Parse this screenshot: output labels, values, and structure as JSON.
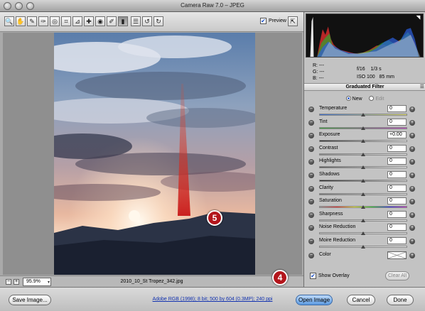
{
  "window": {
    "title": "Camera Raw 7.0  –  JPEG"
  },
  "toolbar": {
    "tools": [
      {
        "name": "zoom-tool",
        "glyph": "🔍"
      },
      {
        "name": "hand-tool",
        "glyph": "✋"
      },
      {
        "name": "white-balance-tool",
        "glyph": "✎"
      },
      {
        "name": "color-sampler-tool",
        "glyph": "✑"
      },
      {
        "name": "targeted-adjustment-tool",
        "glyph": "◎"
      },
      {
        "name": "crop-tool",
        "glyph": "⌗"
      },
      {
        "name": "straighten-tool",
        "glyph": "⊿"
      },
      {
        "name": "spot-removal-tool",
        "glyph": "✚"
      },
      {
        "name": "red-eye-tool",
        "glyph": "◉"
      },
      {
        "name": "adjustment-brush-tool",
        "glyph": "✐"
      },
      {
        "name": "graduated-filter-tool",
        "glyph": "▮"
      },
      {
        "name": "preferences-tool",
        "glyph": "☰"
      },
      {
        "name": "rotate-left-tool",
        "glyph": "↺"
      },
      {
        "name": "rotate-right-tool",
        "glyph": "↻"
      }
    ],
    "active_tool": "graduated-filter-tool",
    "preview_label": "Preview",
    "preview_checked": true
  },
  "status": {
    "zoom": "95.9%",
    "filename": "2010_10_St Tropez_342.jpg"
  },
  "readout": {
    "r_label": "R:",
    "r_value": "---",
    "g_label": "G:",
    "g_value": "---",
    "b_label": "B:",
    "b_value": "---",
    "aperture": "f/16",
    "shutter": "1/3 s",
    "iso": "ISO 100",
    "focal": "85 mm"
  },
  "panel": {
    "title": "Graduated Filter",
    "mode_new": "New",
    "mode_edit": "Edit",
    "mode_selected": "New",
    "params": [
      {
        "label": "Temperature",
        "value": "0",
        "level": 0.5,
        "track": "linear-gradient(90deg,#3b6fd6,#e8e36a)"
      },
      {
        "label": "Tint",
        "value": "0",
        "level": 0.5,
        "track": "linear-gradient(90deg,#3aa33a,#c247c6)"
      },
      {
        "label": "Exposure",
        "value": "+0.00",
        "level": 0.5,
        "track": "linear-gradient(90deg,#222,#fff)"
      },
      {
        "label": "Contrast",
        "value": "0",
        "level": 0.5,
        "track": "linear-gradient(90deg,#888,#eee)"
      },
      {
        "label": "Highlights",
        "value": "0",
        "level": 0.5,
        "track": "linear-gradient(90deg,#555,#fff)"
      },
      {
        "label": "Shadows",
        "value": "0",
        "level": 0.5,
        "track": "linear-gradient(90deg,#222,#ddd)"
      },
      {
        "label": "Clarity",
        "value": "0",
        "level": 0.5,
        "track": "linear-gradient(90deg,#777,#eee)"
      },
      {
        "label": "Saturation",
        "value": "0",
        "level": 0.5,
        "track": "linear-gradient(90deg,#999,#e33,#ee3,#3c3,#33e,#c3c)"
      },
      {
        "label": "Sharpness",
        "value": "0",
        "level": 0.5,
        "track": "linear-gradient(90deg,#aaa,#eee)"
      },
      {
        "label": "Noise Reduction",
        "value": "0",
        "level": 0.5,
        "track": "linear-gradient(90deg,#bbb,#eee)"
      },
      {
        "label": "Moire Reduction",
        "value": "0",
        "level": 0.5,
        "track": "linear-gradient(90deg,#bbb,#eee)"
      }
    ],
    "color_label": "Color",
    "show_overlay_label": "Show Overlay",
    "show_overlay_checked": true,
    "clear_all_label": "Clear All"
  },
  "bottom": {
    "save_label": "Save Image...",
    "workflow": "Adobe RGB (1998); 8 bit; 500 by 604 (0.3MP); 240 ppi",
    "open_label": "Open Image",
    "cancel_label": "Cancel",
    "done_label": "Done"
  },
  "callouts": {
    "four": "4",
    "five": "5"
  }
}
